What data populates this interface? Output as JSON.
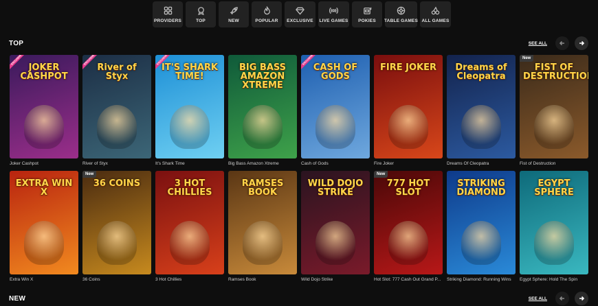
{
  "categories": [
    {
      "label": "PROVIDERS",
      "icon": "grid-icon"
    },
    {
      "label": "TOP",
      "icon": "medal-icon"
    },
    {
      "label": "NEW",
      "icon": "rocket-icon"
    },
    {
      "label": "POPULAR",
      "icon": "flame-icon"
    },
    {
      "label": "EXCLUSIVE",
      "icon": "diamond-icon"
    },
    {
      "label": "LIVE GAMES",
      "icon": "broadcast-icon"
    },
    {
      "label": "POKIES",
      "icon": "slot-machine-icon"
    },
    {
      "label": "TABLE GAMES",
      "icon": "roulette-icon"
    },
    {
      "label": "ALL GAMES",
      "icon": "cherries-icon"
    }
  ],
  "sections": {
    "top": {
      "title": "TOP",
      "see_all": "SEE ALL"
    },
    "new": {
      "title": "NEW",
      "see_all": "SEE ALL"
    }
  },
  "badges": {
    "new": "New",
    "exclusive": "EXCLUSIVE"
  },
  "top_games": [
    {
      "name": "Joker Cashpot",
      "art": "JOKER\nCASHPOT",
      "bg": [
        "#3a1a5c",
        "#9b2e8a"
      ],
      "badge": "exclusive"
    },
    {
      "name": "River of Styx",
      "art": "River of Styx",
      "bg": [
        "#1c2e45",
        "#3c6677"
      ],
      "badge": "exclusive"
    },
    {
      "name": "It's Shark Time",
      "art": "IT'S SHARK TIME!",
      "bg": [
        "#1d8fd6",
        "#6fd0f2"
      ],
      "badge": "exclusive"
    },
    {
      "name": "Big Bass Amazon Xtreme",
      "art": "BIG BASS AMAZON XTREME",
      "bg": [
        "#0f5a3a",
        "#3fa24a"
      ],
      "badge": ""
    },
    {
      "name": "Cash of Gods",
      "art": "CASH OF GODS",
      "bg": [
        "#1e5fb0",
        "#6fa8de"
      ],
      "badge": "exclusive"
    },
    {
      "name": "Fire Joker",
      "art": "FIRE JOKER",
      "bg": [
        "#7a0e0e",
        "#d8471a"
      ],
      "badge": ""
    },
    {
      "name": "Dreams Of Cleopatra",
      "art": "Dreams of Cleopatra",
      "bg": [
        "#13234d",
        "#2c5aa0"
      ],
      "badge": ""
    },
    {
      "name": "Fist of Destruction",
      "art": "FIST OF DESTRUCTION",
      "bg": [
        "#3a2a1a",
        "#8b5a2b"
      ],
      "badge": "new"
    }
  ],
  "new_games": [
    {
      "name": "Extra Win X",
      "art": "EXTRA WIN X",
      "bg": [
        "#b8230f",
        "#f28a1f"
      ],
      "badge": ""
    },
    {
      "name": "36 Coins",
      "art": "36 COINS",
      "bg": [
        "#4a2b10",
        "#c78a1e"
      ],
      "badge": "new"
    },
    {
      "name": "3 Hot Chillies",
      "art": "3 HOT CHILLIES",
      "bg": [
        "#7a1010",
        "#d8401a"
      ],
      "badge": ""
    },
    {
      "name": "Ramses Book",
      "art": "RAMSES BOOK",
      "bg": [
        "#5a3614",
        "#c88a3a"
      ],
      "badge": ""
    },
    {
      "name": "Wild Dojo Strike",
      "art": "WILD DOJO STRIKE",
      "bg": [
        "#2a1420",
        "#7a1a2a"
      ],
      "badge": ""
    },
    {
      "name": "Hot Slot: 777 Cash Out Grand P...",
      "art": "777 HOT SLOT",
      "bg": [
        "#4a0808",
        "#b81818"
      ],
      "badge": "new"
    },
    {
      "name": "Striking Diamond: Running Wins",
      "art": "STRIKING DIAMOND",
      "bg": [
        "#0e3a8a",
        "#2a8ad8"
      ],
      "badge": ""
    },
    {
      "name": "Egypt Sphere: Hold The Spin",
      "art": "EGYPT SPHERE",
      "bg": [
        "#0e6a7a",
        "#3ab8c0"
      ],
      "badge": ""
    }
  ]
}
